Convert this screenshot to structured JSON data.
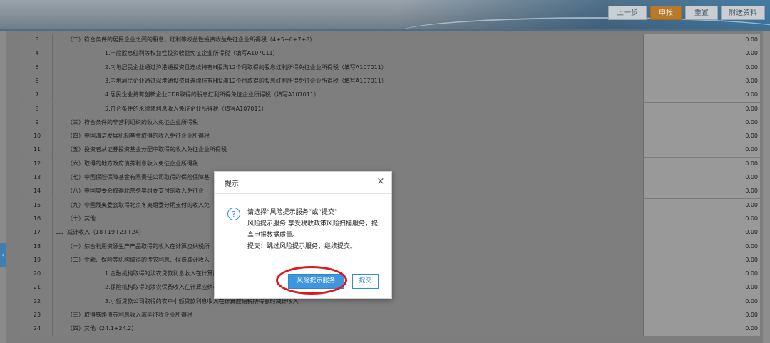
{
  "header": {
    "buttons": [
      "上一步",
      "申报",
      "重置",
      "附送资料"
    ],
    "primary_color": "#b77a2a"
  },
  "table": {
    "rows": [
      {
        "num": "3",
        "desc": "（二）符合条件的居民企业之间的股息、红利等权益性投资收益免征企业所得税（4+5+6+7+8）",
        "value": "0.00"
      },
      {
        "num": "4",
        "desc": "1.一般股息红利等权益性投资收益免征企业所得税（填写A107011）",
        "value": "0.00"
      },
      {
        "num": "5",
        "desc": "2.内地居民企业通过沪港通投资且连续持有H股满12个月取得的股息红利所得免征企业所得税（填写A107011）",
        "value": "0.00"
      },
      {
        "num": "6",
        "desc": "3.内地居民企业通过深港通投资且连续持有H股满12个月取得的股息红利所得免征企业所得税（填写A107011）",
        "value": "0.00"
      },
      {
        "num": "7",
        "desc": "4.居民企业持有创新企业CDR取得的股息红利所得免征企业所得税（填写A107011）",
        "value": "0.00"
      },
      {
        "num": "8",
        "desc": "5.符合条件的永续债利息收入免征企业所得税（填写A107011）",
        "value": "0.00"
      },
      {
        "num": "9",
        "desc": "（三）符合条件的非营利组织的收入免征企业所得税",
        "value": "0.00"
      },
      {
        "num": "10",
        "desc": "（四）中国清洁发展机制基金取得的收入免征企业所得税",
        "value": "0.00"
      },
      {
        "num": "11",
        "desc": "（五）投资者从证券投资基金分配中取得的收入免征企业所得税",
        "value": "0.00"
      },
      {
        "num": "12",
        "desc": "（六）取得的地方政府债券利息收入免征企业所得税",
        "value": "0.00"
      },
      {
        "num": "13",
        "desc": "（七）中国保险保障基金有限责任公司取得的保险保障基",
        "value": "0.00"
      },
      {
        "num": "14",
        "desc": "（八）中国奥委会取得北京冬奥组委支付的收入免征企",
        "value": "0.00"
      },
      {
        "num": "15",
        "desc": "（九）中国残奥委会取得北京冬奥组委分期支付的收入免",
        "value": "0.00"
      },
      {
        "num": "16",
        "desc": "（十）其他",
        "value": "0.00"
      },
      {
        "num": "17",
        "desc": "二、减计收入（18+19+23+24）",
        "value": "0.00"
      },
      {
        "num": "18",
        "desc": "（一）综合利用资源生产产品取得的收入在计算应纳税所",
        "value": "0.00"
      },
      {
        "num": "19",
        "desc": "（二）金融、保险等机构取得的涉农利息、保费减计收入",
        "value": "0.00"
      },
      {
        "num": "20",
        "desc": "1.金融机构取得的涉农贷款利息收入在计算应纳税",
        "value": "0.00"
      },
      {
        "num": "21",
        "desc": "2.保险机构取得的涉农保费收入在计算应纳税所得",
        "value": "0.00"
      },
      {
        "num": "22",
        "desc": "3.小额贷款公司取得的农户小额贷款利息收入在计算应纳税所得额时减计收入",
        "value": "0.00"
      },
      {
        "num": "23",
        "desc": "（三）取得铁路债券利息收入减半征收企业所得税",
        "value": "0.00"
      },
      {
        "num": "24",
        "desc": "（四）其他（24.1+24.2）",
        "value": "0.00"
      }
    ]
  },
  "modal": {
    "title": "提示",
    "close": "×",
    "icon": "?",
    "line1": "请选择“风险提示服务”或“提交”",
    "line2": "风险提示服务:享受税收政策风险扫描服务，提高申报数据质量。",
    "line3": "提交：跳过风险提示服务，继续提交。",
    "risk_button": "风险提示服务",
    "submit_button": "提交",
    "highlight_color": "#e0171e"
  },
  "sidebar": {
    "collapse_glyph": "‹"
  }
}
